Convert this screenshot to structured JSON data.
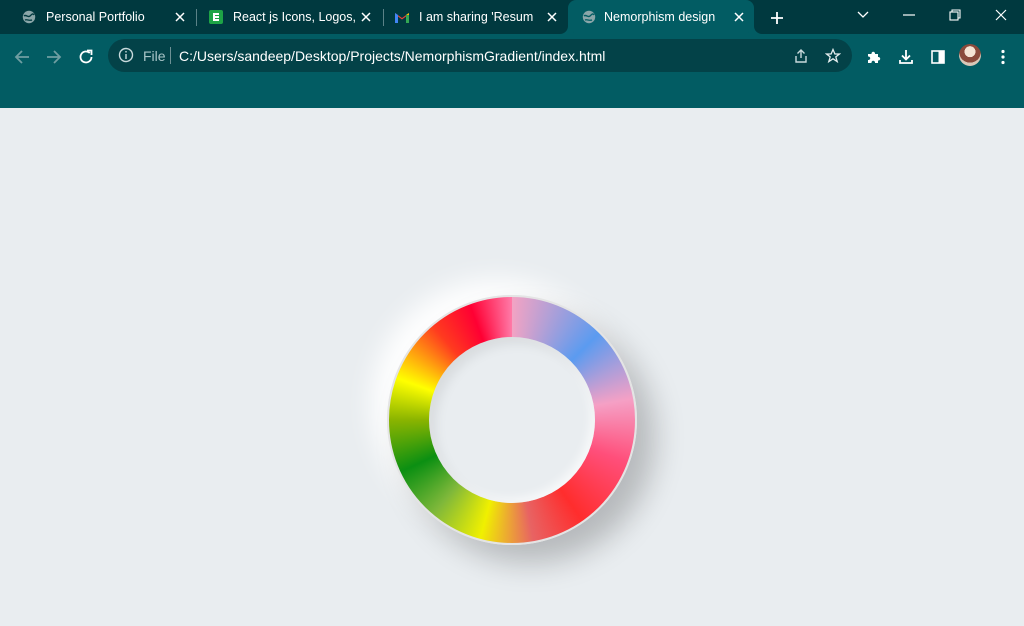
{
  "browser": {
    "tabs": [
      {
        "title": "Personal Portfolio",
        "favicon": "globe-icon",
        "active": false
      },
      {
        "title": "React js Icons, Logos, Sy",
        "favicon": "react-icons-favicon",
        "active": false
      },
      {
        "title": "I am sharing 'Resume C",
        "favicon": "gmail-icon",
        "active": false
      },
      {
        "title": "Nemorphism design",
        "favicon": "globe-icon",
        "active": true
      }
    ],
    "address_bar": {
      "scheme_label": "File",
      "url": "C:/Users/sandeep/Desktop/Projects/NemorphismGradient/index.html"
    }
  },
  "colors": {
    "tabstrip_bg": "#00393f",
    "toolbar_bg": "#025c63",
    "page_bg": "#e9edf0"
  }
}
